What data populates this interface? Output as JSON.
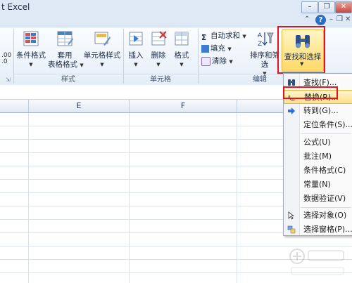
{
  "window": {
    "title": "t Excel",
    "minimize": "–",
    "restore": "❐",
    "close": "✕"
  },
  "help": {
    "up": "⌃",
    "help": "?",
    "minimize": "–",
    "restore": "❐",
    "close": "✕"
  },
  "ribbon": {
    "styles_group": {
      "label": "样式",
      "cond_format": "条件格式",
      "table_format_1": "套用",
      "table_format_2": "表格格式",
      "cell_styles": "单元格样式"
    },
    "cells_group": {
      "label": "单元格",
      "insert": "插入",
      "delete": "删除",
      "format": "格式"
    },
    "edit_group": {
      "label": "编辑",
      "autosum": "自动求和",
      "fill": "填充",
      "clear": "清除",
      "sort_filter": "排序和筛选",
      "find_select": "查找和选择"
    },
    "left_partial_label": ".00\n.0"
  },
  "columns": [
    "E",
    "F"
  ],
  "menu": {
    "items": [
      {
        "label": "查找(F)...",
        "icon": "binoculars-icon"
      },
      {
        "label": "替换(R)...",
        "icon": "replace-icon"
      },
      {
        "label": "转到(G)...",
        "icon": "arrow-right-icon"
      },
      {
        "label": "定位条件(S)...",
        "icon": ""
      },
      {
        "label": "公式(U)",
        "icon": ""
      },
      {
        "label": "批注(M)",
        "icon": ""
      },
      {
        "label": "条件格式(C)",
        "icon": ""
      },
      {
        "label": "常量(N)",
        "icon": ""
      },
      {
        "label": "数据验证(V)",
        "icon": ""
      },
      {
        "label": "选择对象(O)",
        "icon": "pointer-icon"
      },
      {
        "label": "选择窗格(P)...",
        "icon": "selection-pane-icon"
      }
    ]
  },
  "colors": {
    "highlight_red": "#e8121e",
    "hover_gold": "#ffd966"
  }
}
